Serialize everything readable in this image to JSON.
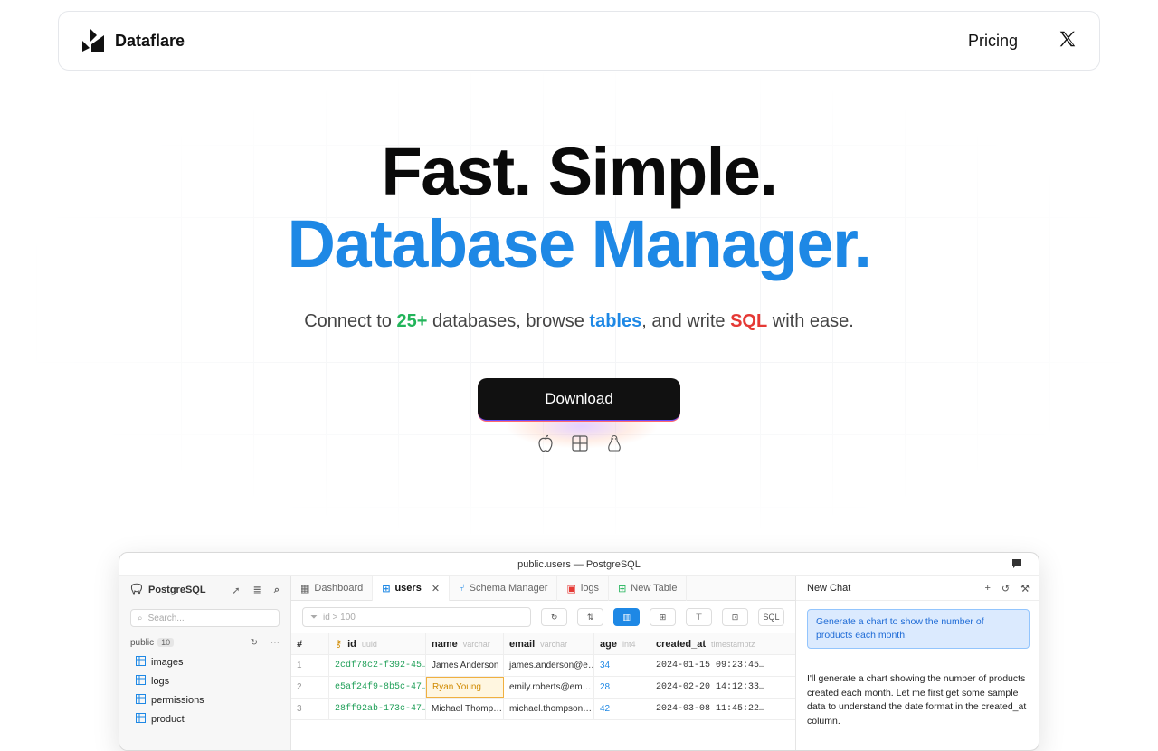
{
  "nav": {
    "brand": "Dataflare",
    "pricing": "Pricing",
    "x_icon": "x-twitter-icon"
  },
  "hero": {
    "line1": "Fast. Simple.",
    "line2": "Database Manager.",
    "sub_1": "Connect to ",
    "sub_count": "25+",
    "sub_2": " databases, browse ",
    "sub_tables": "tables",
    "sub_3": ", and write ",
    "sub_sql": "SQL",
    "sub_4": " with ease.",
    "download": "Download",
    "os_icons": [
      "apple-icon",
      "windows-icon",
      "linux-icon"
    ],
    "colors": {
      "accent_blue": "#1e88e5",
      "accent_green": "#22b45a",
      "accent_red": "#e53935"
    }
  },
  "app": {
    "window_title": "public.users — PostgreSQL",
    "sidebar": {
      "db": "PostgreSQL",
      "search_placeholder": "Search...",
      "schema": "public",
      "schema_count": "10",
      "items": [
        "images",
        "logs",
        "permissions",
        "product"
      ]
    },
    "tabs": [
      {
        "label": "Dashboard"
      },
      {
        "label": "users",
        "active": true
      },
      {
        "label": "Schema Manager"
      },
      {
        "label": "logs"
      },
      {
        "label": "New Table"
      }
    ],
    "filter_placeholder": "id > 100",
    "sql_label": "SQL",
    "columns": [
      {
        "name": "#",
        "type": ""
      },
      {
        "name": "id",
        "type": "uuid"
      },
      {
        "name": "name",
        "type": "varchar"
      },
      {
        "name": "email",
        "type": "varchar"
      },
      {
        "name": "age",
        "type": "int4"
      },
      {
        "name": "created_at",
        "type": "timestamptz"
      }
    ],
    "rows": [
      {
        "n": "1",
        "id": "2cdf78c2-f392-45…",
        "name": "James Anderson",
        "email": "james.anderson@e…",
        "age": "34",
        "created": "2024-01-15 09:23:45…"
      },
      {
        "n": "2",
        "id": "e5af24f9-8b5c-47…",
        "name": "Ryan Young",
        "email": "emily.roberts@em…",
        "age": "28",
        "created": "2024-02-20 14:12:33…"
      },
      {
        "n": "3",
        "id": "28ff92ab-173c-47…",
        "name": "Michael Thomp…",
        "email": "michael.thompson…",
        "age": "42",
        "created": "2024-03-08 11:45:22…"
      }
    ],
    "chat": {
      "title": "New Chat",
      "prompt": "Generate a chart to show the number of products each month.",
      "reply": "I'll generate a chart showing the number of products created each month. Let me first get some sample data to understand the date format in the created_at column."
    }
  }
}
